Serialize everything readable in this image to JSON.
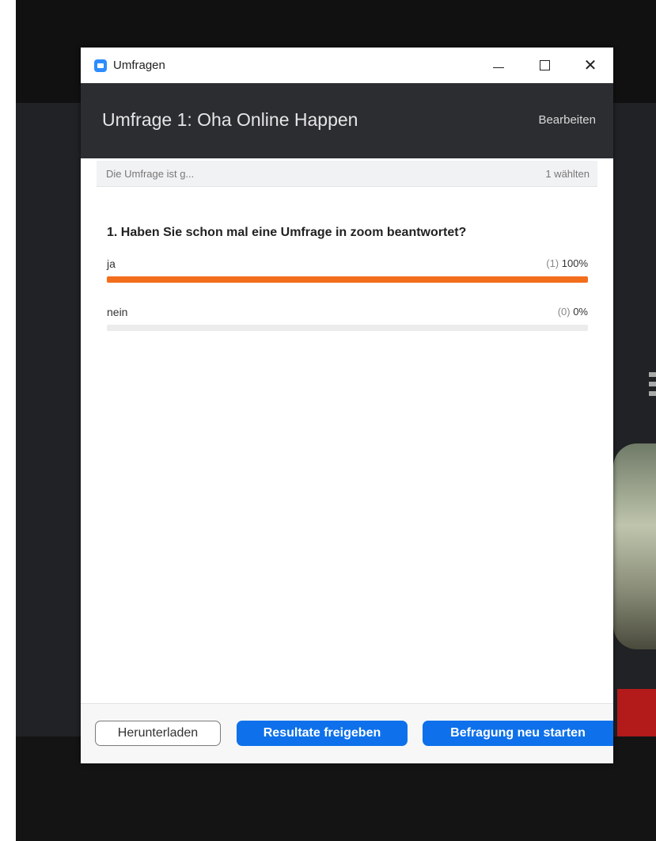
{
  "window": {
    "title": "Umfragen",
    "icon": "zoom-camera-icon",
    "controls": {
      "minimize_icon": "minimize-icon",
      "maximize_icon": "maximize-icon",
      "close_icon": "close-icon",
      "close_glyph": "✕"
    }
  },
  "header": {
    "poll_title": "Umfrage 1: Oha Online Happen",
    "edit_label": "Bearbeiten"
  },
  "status": {
    "state_text": "Die Umfrage ist g...",
    "voters_text": "1 wählten"
  },
  "question": {
    "text": "1. Haben Sie schon mal eine Umfrage in zoom beantwortet?",
    "answers": [
      {
        "label": "ja",
        "count": "(1)",
        "percent": "100%",
        "fraction": 1.0
      },
      {
        "label": "nein",
        "count": "(0)",
        "percent": "0%",
        "fraction": 0.0
      }
    ]
  },
  "footer": {
    "download_label": "Herunterladen",
    "share_label": "Resultate freigeben",
    "restart_label": "Befragung neu starten"
  },
  "colors": {
    "accent_blue": "#0e71eb",
    "bar_orange": "#f26e1d",
    "header_dark": "#2b2d31"
  }
}
